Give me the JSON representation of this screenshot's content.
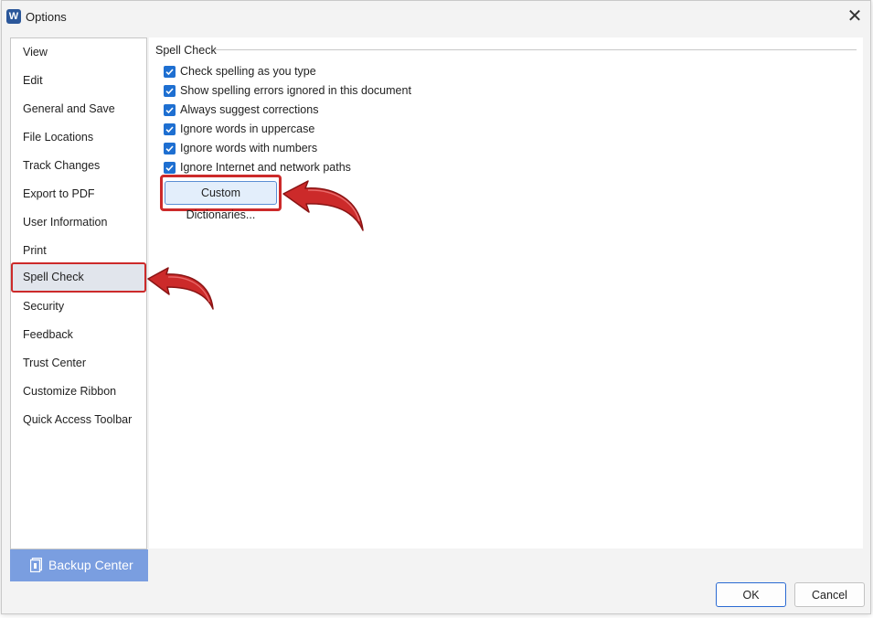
{
  "window": {
    "title": "Options",
    "app_icon_letter": "W",
    "close_glyph": "✕"
  },
  "sidebar": {
    "items": [
      {
        "label": "View"
      },
      {
        "label": "Edit"
      },
      {
        "label": "General and Save"
      },
      {
        "label": "File Locations"
      },
      {
        "label": "Track Changes"
      },
      {
        "label": "Export to PDF"
      },
      {
        "label": "User Information"
      },
      {
        "label": "Print"
      },
      {
        "label": "Spell Check",
        "selected": true
      },
      {
        "label": "Security"
      },
      {
        "label": "Feedback"
      },
      {
        "label": "Trust Center"
      },
      {
        "label": "Customize Ribbon"
      },
      {
        "label": "Quick Access Toolbar"
      }
    ],
    "backup_center_label": "Backup Center"
  },
  "content": {
    "section_title": "Spell Check",
    "checkboxes": [
      {
        "label": "Check spelling as you type",
        "checked": true
      },
      {
        "label": "Show spelling errors ignored in this document",
        "checked": true
      },
      {
        "label": "Always suggest corrections",
        "checked": true
      },
      {
        "label": "Ignore words in uppercase",
        "checked": true
      },
      {
        "label": "Ignore words with numbers",
        "checked": true
      },
      {
        "label": "Ignore Internet and network paths",
        "checked": true
      }
    ],
    "custom_dictionaries_label": "Custom Dictionaries..."
  },
  "footer": {
    "ok_label": "OK",
    "cancel_label": "Cancel"
  },
  "colors": {
    "accent": "#1e6fd1",
    "highlight_red": "#cc2a2a",
    "backup_bg": "#7a9ee0"
  }
}
